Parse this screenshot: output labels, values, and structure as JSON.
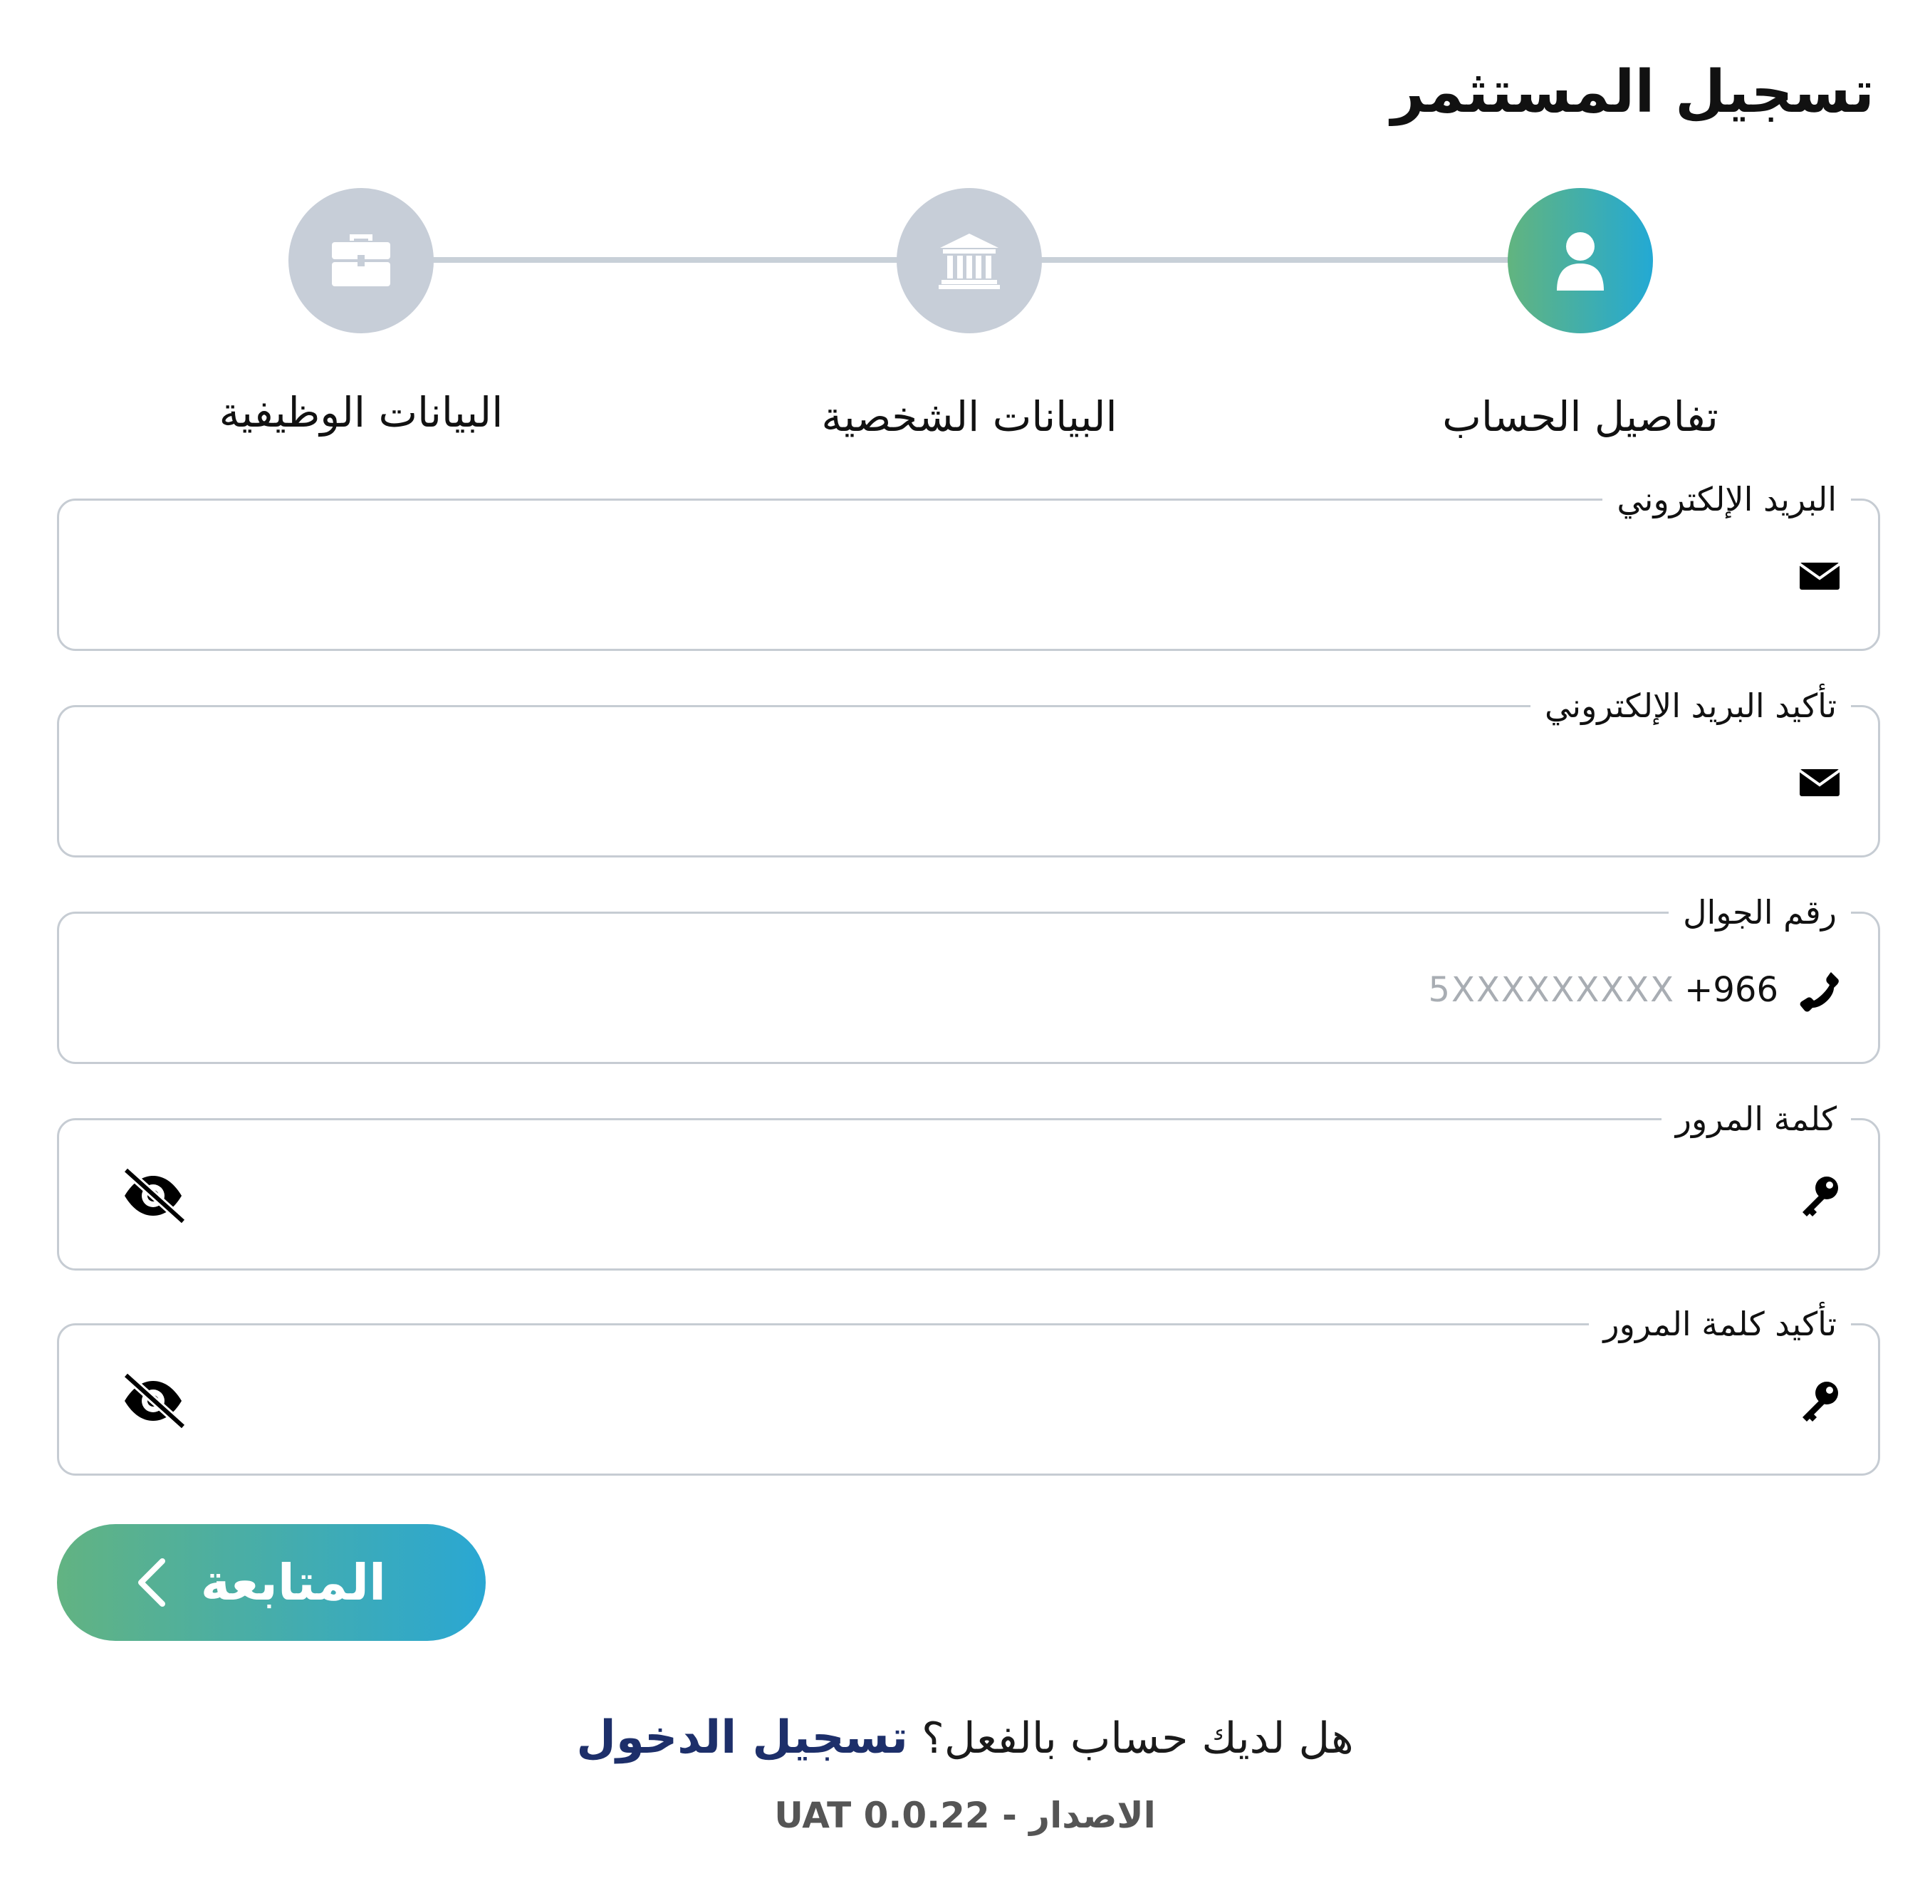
{
  "page": {
    "title": "تسجيل المستثمر"
  },
  "stepper": {
    "steps": [
      {
        "label": "تفاصيل الحساب",
        "icon": "user-icon",
        "active": true
      },
      {
        "label": "البيانات الشخصية",
        "icon": "bank-icon",
        "active": false
      },
      {
        "label": "البيانات الوظيفية",
        "icon": "briefcase-icon",
        "active": false
      }
    ]
  },
  "form": {
    "email": {
      "label": "البريد الإلكتروني",
      "value": "",
      "icon": "mail-icon"
    },
    "confirm_email": {
      "label": "تأكيد البريد الإلكتروني",
      "value": "",
      "icon": "mail-icon"
    },
    "mobile": {
      "label": "رقم الجوال",
      "prefix": "+966",
      "placeholder": "5XXXXXXXXX",
      "icon": "phone-icon"
    },
    "password": {
      "label": "كلمة المرور",
      "value": "",
      "icon": "key-icon",
      "toggle_icon": "eye-off-icon"
    },
    "confirm_password": {
      "label": "تأكيد كلمة المرور",
      "value": "",
      "icon": "key-icon",
      "toggle_icon": "eye-off-icon"
    }
  },
  "actions": {
    "continue_label": "المتابعة",
    "continue_icon": "chevron-left-icon"
  },
  "footer": {
    "login_prompt": "هل لديك حساب بالفعل؟",
    "login_link": "تسجيل الدخول",
    "version": "الاصدار - UAT 0.0.22"
  },
  "colors": {
    "gradient_start": "#62b382",
    "gradient_end": "#2aa7d3",
    "step_inactive": "#c7ced8",
    "link": "#1d2f6a",
    "field_border": "#c6ccd3"
  }
}
